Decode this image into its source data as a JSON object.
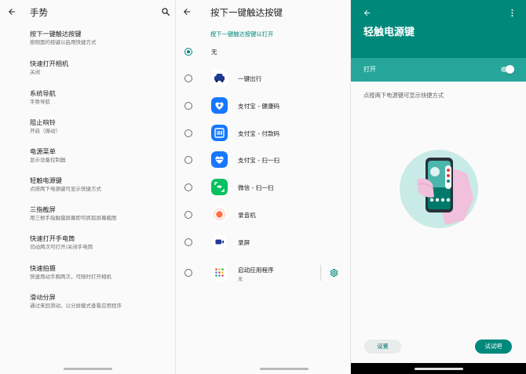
{
  "panel1": {
    "title": "手势",
    "items": [
      {
        "title": "按下一键触达按键",
        "subtitle": "按侧面的按键以启用快捷方式"
      },
      {
        "title": "快速打开相机",
        "subtitle": "关闭"
      },
      {
        "title": "系统导航",
        "subtitle": "手势导航"
      },
      {
        "title": "阻止响铃",
        "subtitle": "开启（振动）"
      },
      {
        "title": "电源菜单",
        "subtitle": "显示设备控制器"
      },
      {
        "title": "轻触电源键",
        "subtitle": "点按两下电源键可显示快捷方式"
      },
      {
        "title": "三指截屏",
        "subtitle": "用三根手指触摸屏幕即可抓取屏幕截图"
      },
      {
        "title": "快速打开手电筒",
        "subtitle": "切动两次可打开/关闭手电筒"
      },
      {
        "title": "快速拍摄",
        "subtitle": "快速用动手腕两次，可随时打开相机"
      },
      {
        "title": "滑动分屏",
        "subtitle": "通过来回滑动，以分屏模式查看应用程序"
      }
    ]
  },
  "panel2": {
    "title": "按下一键触达按键",
    "section_label": "按下一键触达按键以打开",
    "options": [
      {
        "label": "无",
        "subtitle": "",
        "checked": true,
        "icon": "none"
      },
      {
        "label": "一键出行",
        "subtitle": "",
        "checked": false,
        "icon": "car-icon"
      },
      {
        "label": "支付宝 - 健康码",
        "subtitle": "",
        "checked": false,
        "icon": "alipay-health-icon"
      },
      {
        "label": "支付宝 - 付款码",
        "subtitle": "",
        "checked": false,
        "icon": "alipay-pay-icon"
      },
      {
        "label": "支付宝 - 扫一扫",
        "subtitle": "",
        "checked": false,
        "icon": "alipay-scan-icon"
      },
      {
        "label": "微信 - 扫一扫",
        "subtitle": "",
        "checked": false,
        "icon": "wechat-scan-icon"
      },
      {
        "label": "录音机",
        "subtitle": "",
        "checked": false,
        "icon": "recorder-icon"
      },
      {
        "label": "录屏",
        "subtitle": "",
        "checked": false,
        "icon": "screen-record-icon"
      },
      {
        "label": "启动应用程序",
        "subtitle": "无",
        "checked": false,
        "icon": "app-launcher-icon"
      }
    ]
  },
  "panel3": {
    "title": "轻触电源键",
    "switch_label": "打开",
    "switch_on": true,
    "description": "点按两下电源键可显示快捷方式",
    "setup_button": "设置",
    "try_button": "试试吧"
  },
  "colors": {
    "accent": "#00897b",
    "accent_light": "#26a69a",
    "background": "#fafafa",
    "alipay_blue": "#1677ff",
    "wechat_green": "#07c160",
    "recorder_orange": "#ff7043"
  }
}
